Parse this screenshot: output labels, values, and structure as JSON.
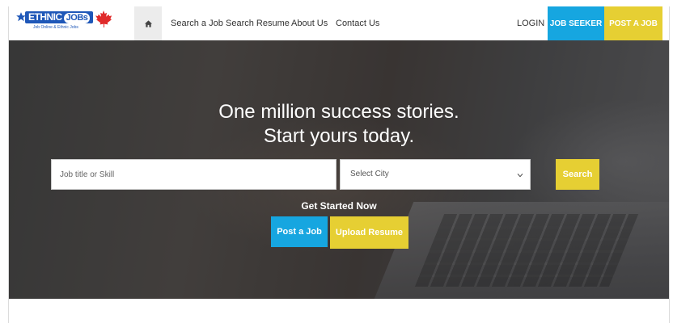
{
  "logo": {
    "brand": "ETHNIC",
    "brand_suffix": "JOBs",
    "tagline": "Job Online & Ethnic Jobs"
  },
  "nav": {
    "links": [
      "Search a Job",
      "Search Resume",
      "About Us",
      "Contact Us"
    ],
    "login": "LOGIN",
    "job_seeker": "JOB SEEKER",
    "post_a_job": "POST A JOB"
  },
  "hero": {
    "headline_line1": "One million success stories.",
    "headline_line2": "Start yours today.",
    "search_placeholder": "Job title or Skill",
    "city_select": "Select City",
    "search_button": "Search",
    "get_started": "Get Started Now",
    "post_job_button": "Post a Job",
    "upload_resume_button": "Upload Resume"
  },
  "colors": {
    "accent_blue": "#16a6e0",
    "accent_yellow": "#e6cf33",
    "logo_blue": "#1e57b8",
    "maple_red": "#e02a2a"
  },
  "icons": [
    "home-icon",
    "maple-leaf-icon",
    "star-icon",
    "chevron-down-icon"
  ]
}
